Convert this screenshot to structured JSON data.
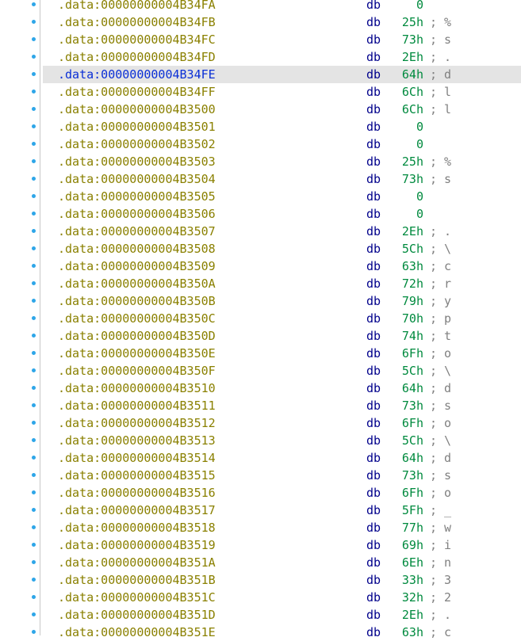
{
  "listing": {
    "selected_index": 4,
    "rows": [
      {
        "addr": ".data:00000000004B34FA",
        "mnem": "db",
        "val": "0",
        "cmt": ""
      },
      {
        "addr": ".data:00000000004B34FB",
        "mnem": "db",
        "val": "25h",
        "cmt": "; %"
      },
      {
        "addr": ".data:00000000004B34FC",
        "mnem": "db",
        "val": "73h",
        "cmt": "; s"
      },
      {
        "addr": ".data:00000000004B34FD",
        "mnem": "db",
        "val": "2Eh",
        "cmt": "; ."
      },
      {
        "addr": ".data:00000000004B34FE",
        "mnem": "db",
        "val": "64h",
        "cmt": "; d"
      },
      {
        "addr": ".data:00000000004B34FF",
        "mnem": "db",
        "val": "6Ch",
        "cmt": "; l"
      },
      {
        "addr": ".data:00000000004B3500",
        "mnem": "db",
        "val": "6Ch",
        "cmt": "; l"
      },
      {
        "addr": ".data:00000000004B3501",
        "mnem": "db",
        "val": "0",
        "cmt": ""
      },
      {
        "addr": ".data:00000000004B3502",
        "mnem": "db",
        "val": "0",
        "cmt": ""
      },
      {
        "addr": ".data:00000000004B3503",
        "mnem": "db",
        "val": "25h",
        "cmt": "; %"
      },
      {
        "addr": ".data:00000000004B3504",
        "mnem": "db",
        "val": "73h",
        "cmt": "; s"
      },
      {
        "addr": ".data:00000000004B3505",
        "mnem": "db",
        "val": "0",
        "cmt": ""
      },
      {
        "addr": ".data:00000000004B3506",
        "mnem": "db",
        "val": "0",
        "cmt": ""
      },
      {
        "addr": ".data:00000000004B3507",
        "mnem": "db",
        "val": "2Eh",
        "cmt": "; ."
      },
      {
        "addr": ".data:00000000004B3508",
        "mnem": "db",
        "val": "5Ch",
        "cmt": "; \\"
      },
      {
        "addr": ".data:00000000004B3509",
        "mnem": "db",
        "val": "63h",
        "cmt": "; c"
      },
      {
        "addr": ".data:00000000004B350A",
        "mnem": "db",
        "val": "72h",
        "cmt": "; r"
      },
      {
        "addr": ".data:00000000004B350B",
        "mnem": "db",
        "val": "79h",
        "cmt": "; y"
      },
      {
        "addr": ".data:00000000004B350C",
        "mnem": "db",
        "val": "70h",
        "cmt": "; p"
      },
      {
        "addr": ".data:00000000004B350D",
        "mnem": "db",
        "val": "74h",
        "cmt": "; t"
      },
      {
        "addr": ".data:00000000004B350E",
        "mnem": "db",
        "val": "6Fh",
        "cmt": "; o"
      },
      {
        "addr": ".data:00000000004B350F",
        "mnem": "db",
        "val": "5Ch",
        "cmt": "; \\"
      },
      {
        "addr": ".data:00000000004B3510",
        "mnem": "db",
        "val": "64h",
        "cmt": "; d"
      },
      {
        "addr": ".data:00000000004B3511",
        "mnem": "db",
        "val": "73h",
        "cmt": "; s"
      },
      {
        "addr": ".data:00000000004B3512",
        "mnem": "db",
        "val": "6Fh",
        "cmt": "; o"
      },
      {
        "addr": ".data:00000000004B3513",
        "mnem": "db",
        "val": "5Ch",
        "cmt": "; \\"
      },
      {
        "addr": ".data:00000000004B3514",
        "mnem": "db",
        "val": "64h",
        "cmt": "; d"
      },
      {
        "addr": ".data:00000000004B3515",
        "mnem": "db",
        "val": "73h",
        "cmt": "; s"
      },
      {
        "addr": ".data:00000000004B3516",
        "mnem": "db",
        "val": "6Fh",
        "cmt": "; o"
      },
      {
        "addr": ".data:00000000004B3517",
        "mnem": "db",
        "val": "5Fh",
        "cmt": "; _"
      },
      {
        "addr": ".data:00000000004B3518",
        "mnem": "db",
        "val": "77h",
        "cmt": "; w"
      },
      {
        "addr": ".data:00000000004B3519",
        "mnem": "db",
        "val": "69h",
        "cmt": "; i"
      },
      {
        "addr": ".data:00000000004B351A",
        "mnem": "db",
        "val": "6Eh",
        "cmt": "; n"
      },
      {
        "addr": ".data:00000000004B351B",
        "mnem": "db",
        "val": "33h",
        "cmt": "; 3"
      },
      {
        "addr": ".data:00000000004B351C",
        "mnem": "db",
        "val": "32h",
        "cmt": "; 2"
      },
      {
        "addr": ".data:00000000004B351D",
        "mnem": "db",
        "val": "2Eh",
        "cmt": "; ."
      },
      {
        "addr": ".data:00000000004B351E",
        "mnem": "db",
        "val": "63h",
        "cmt": "; c"
      }
    ]
  },
  "colors": {
    "address": "#8a8000",
    "address_selected": "#0a2fd6",
    "mnemonic": "#00008b",
    "value": "#008a3e",
    "comment": "#808080",
    "selection": "#e4e4e4",
    "gutter_dot": "#2ea6e8"
  },
  "icons": {
    "gutter_marker": "breakpoint-dot-icon"
  }
}
